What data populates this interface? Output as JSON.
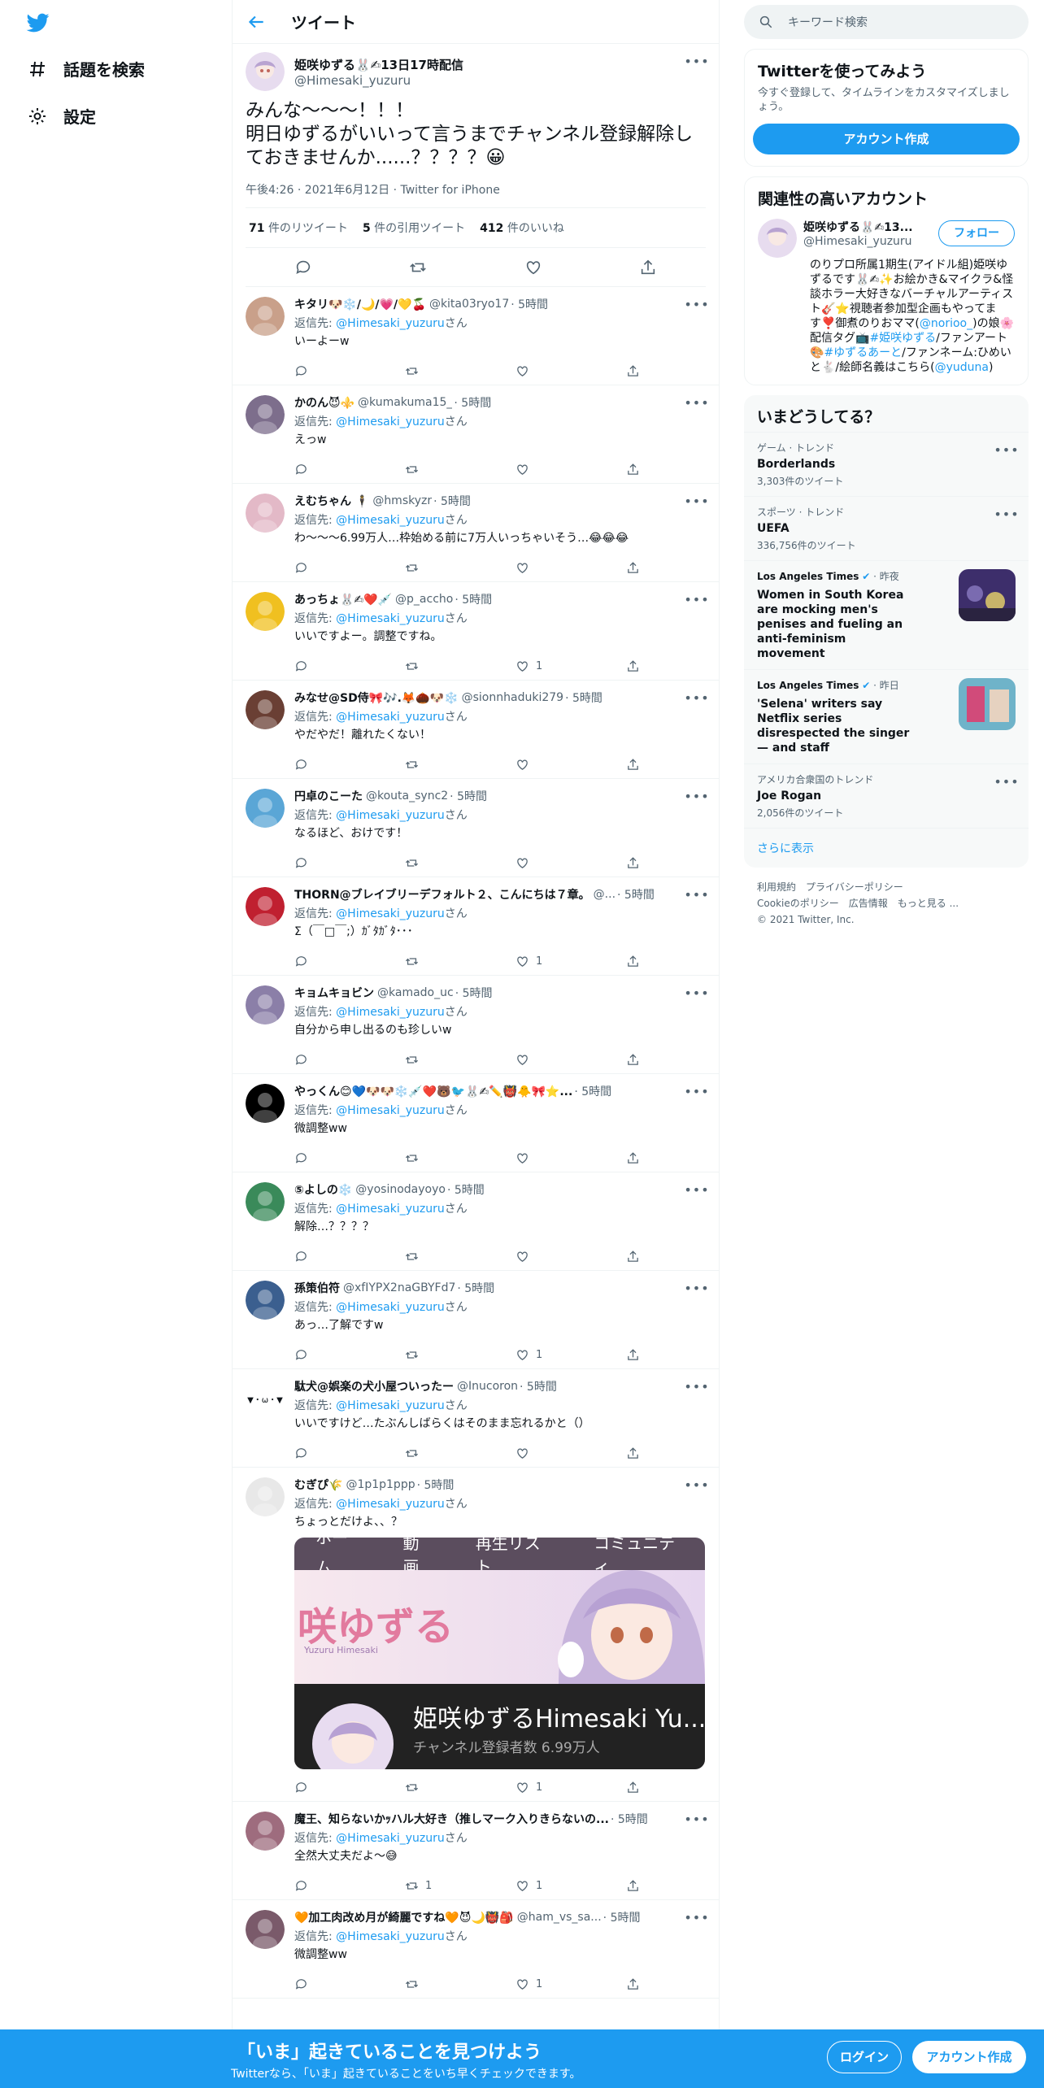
{
  "nav": {
    "explore": "話題を検索",
    "settings": "設定"
  },
  "header": {
    "title": "ツイート"
  },
  "focal": {
    "name": "姫咲ゆずる🐰✍13日17時配信",
    "handle": "@Himesaki_yuzuru",
    "text": "みんな〜〜〜！！！\n明日ゆずるがいいって言うまでチャンネル登録解除しておきませんか......？？？？😀",
    "meta": "午後4:26 · 2021年6月12日 · Twitter for iPhone",
    "retweets_count": "71",
    "retweets_label": "件のリツイート",
    "quotes_count": "5",
    "quotes_label": "件の引用ツイート",
    "likes_count": "412",
    "likes_label": "件のいいね"
  },
  "reply_prefix": "返信先: ",
  "reply_suffix": "さん",
  "reply_to": "@Himesaki_yuzuru",
  "replies": [
    {
      "name": "キタリ🐶❄️/🌙/💗/💛🍒",
      "handle": "@kita03ryo17",
      "time": "· 5時間",
      "text": "いーよーw",
      "rt": "",
      "like": "",
      "color": "#c9a08a"
    },
    {
      "name": "かのん😈⚜️",
      "handle": "@kumakuma15_",
      "time": "· 5時間",
      "text": "えっw",
      "rt": "",
      "like": "",
      "color": "#7d6e8c"
    },
    {
      "name": "えむちゃん 🕴",
      "handle": "@hmskyzr",
      "time": "· 5時間",
      "text": "わ〜〜〜6.99万人…枠始める前に7万人いっちゃいそう…😂😂😂",
      "rt": "",
      "like": "",
      "color": "#e3b9c7"
    },
    {
      "name": "あっちょ🐰✍❤️💉",
      "handle": "@p_accho",
      "time": "· 5時間",
      "text": "いいですよー。調整ですね。",
      "rt": "",
      "like": "1",
      "color": "#f0c020"
    },
    {
      "name": "みなせ@SD侍🎀🎶.🦊🌰🐶❄️",
      "handle": "@sionnhaduki279",
      "time": "· 5時間",
      "text": "やだやだ！離れたくない！",
      "rt": "",
      "like": "",
      "color": "#6a3f34"
    },
    {
      "name": "円卓のこーた",
      "handle": "@kouta_sync2",
      "time": "· 5時間",
      "text": "なるほど、おけです！",
      "rt": "",
      "like": "",
      "color": "#5aa6d6"
    },
    {
      "name": "THORN@ブレイブリーデフォルト２、こんにちは７章。",
      "handle": "@...",
      "time": "· 5時間",
      "text": "Σ（￣□￣;）ｶﾞﾀｶﾞﾀ･･･",
      "rt": "",
      "like": "1",
      "color": "#c02030"
    },
    {
      "name": "キョムキョビン",
      "handle": "@kamado_uc",
      "time": "· 5時間",
      "text": "自分から申し出るのも珍しいw",
      "rt": "",
      "like": "",
      "color": "#8b7fa8"
    },
    {
      "name": "やっくん😊💙🐶🐶❄️💉❤️🐻🐦🐰✍✏️👹🐥🎀⭐...",
      "handle": "",
      "time": "· 5時間",
      "text": "微調整ww",
      "rt": "",
      "like": "",
      "color": "#000000"
    },
    {
      "name": "⑤よしの❄️",
      "handle": "@yosinodayoyo",
      "time": "· 5時間",
      "text": "解除…？？？？",
      "rt": "",
      "like": "",
      "color": "#3a8a5a"
    },
    {
      "name": "孫策伯符",
      "handle": "@xfIYPX2naGBYFd7",
      "time": "· 5時間",
      "text": "あっ…了解ですw",
      "rt": "",
      "like": "1",
      "color": "#3b5f8f"
    },
    {
      "name": "駄犬@娯楽の犬小屋ついったー",
      "handle": "@Inucoron",
      "time": "· 5時間",
      "text": "いいですけど…たぶんしばらくはそのまま忘れるかと（）",
      "rt": "",
      "like": "",
      "color": "#ffffff",
      "avatar_text": "▼・ω・▼"
    },
    {
      "name": "むぎぴ🌾",
      "handle": "@1p1p1ppp",
      "time": "· 5時間",
      "text": "ちょっとだけよ、、？",
      "rt": "",
      "like": "1",
      "color": "#e8e8e8",
      "has_image": true
    },
    {
      "name": "魔王、知らないかｯハル大好き（推しマーク入りきらないの...",
      "handle": "",
      "time": "· 5時間",
      "text": "全然大丈夫だよ〜😅",
      "rt": "1",
      "like": "1",
      "color": "#9e6c7e"
    },
    {
      "name": "🧡加工肉改め月が綺麗ですね🧡😈🌙👹🎒",
      "handle": "@ham_vs_sa...",
      "time": "· 5時間",
      "text": "微調整ww",
      "rt": "",
      "like": "1",
      "color": "#7a5a6a"
    }
  ],
  "embed": {
    "tabs": [
      "ホーム",
      "動画",
      "再生リスト",
      "コミュニティ"
    ],
    "logo_text": "咲ゆずる",
    "logo_sub": "Yuzuru Himesaki",
    "channel": "姫咲ゆずるHimesaki Yu...",
    "subs": "チャンネル登録者数 6.99万人"
  },
  "sidebar": {
    "search_placeholder": "キーワード検索",
    "signup_title": "Twitterを使ってみよう",
    "signup_sub": "今すぐ登録して、タイムラインをカスタマイズしましょう。",
    "signup_button": "アカウント作成",
    "rec_title": "関連性の高いアカウント",
    "rec_name": "姫咲ゆずる🐰✍13...",
    "rec_handle": "@Himesaki_yuzuru",
    "follow": "フォロー",
    "bio_1": "のりプロ所属1期生(アイドル組)姫咲ゆずるです🐰✍✨お絵かき&マイクラ&怪談ホラー大好きなバーチャルアーティスト🎸⭐視聴者参加型企画もやってます❣️御煮のりおママ(",
    "bio_link1": "@norioo_",
    "bio_2": ")の娘🌸配信タグ📺",
    "bio_link2": "#姫咲ゆずる",
    "bio_3": "/ファンアート🎨",
    "bio_link3": "#ゆずるあーと",
    "bio_4": "/ファンネーム:ひめいと🐇/絵師名義はこちら(",
    "bio_link4": "@yuduna",
    "bio_5": ")",
    "trends_title": "いまどうしてる？",
    "trends": [
      {
        "meta": "ゲーム · トレンド",
        "name": "Borderlands",
        "count": "3,303件のツイート"
      },
      {
        "meta": "スポーツ · トレンド",
        "name": "UEFA",
        "count": "336,756件のツイート"
      }
    ],
    "news": [
      {
        "source": "Los Angeles Times",
        "time": "· 昨夜",
        "title": "Women in South Korea are mocking men's penises and fueling an anti-feminism movement"
      },
      {
        "source": "Los Angeles Times",
        "time": "· 昨日",
        "title": "'Selena' writers say Netflix series disrespected the singer — and staff"
      }
    ],
    "trend3": {
      "meta": "アメリカ合衆国のトレンド",
      "name": "Joe Rogan",
      "count": "2,056件のツイート"
    },
    "show_more": "さらに表示",
    "footer": [
      "利用規約",
      "プライバシーポリシー",
      "Cookieのポリシー",
      "広告情報",
      "もっと見る ...",
      "© 2021 Twitter, Inc."
    ]
  },
  "bottom": {
    "title": "「いま」起きていることを見つけよう",
    "sub": "Twitterなら、「いま」起きていることをいち早くチェックできます。",
    "login": "ログイン",
    "signup": "アカウント作成"
  },
  "colors": {
    "accent": "#1d9bf0",
    "text": "#0f1419",
    "muted": "#536471",
    "border": "#eff3f4"
  }
}
